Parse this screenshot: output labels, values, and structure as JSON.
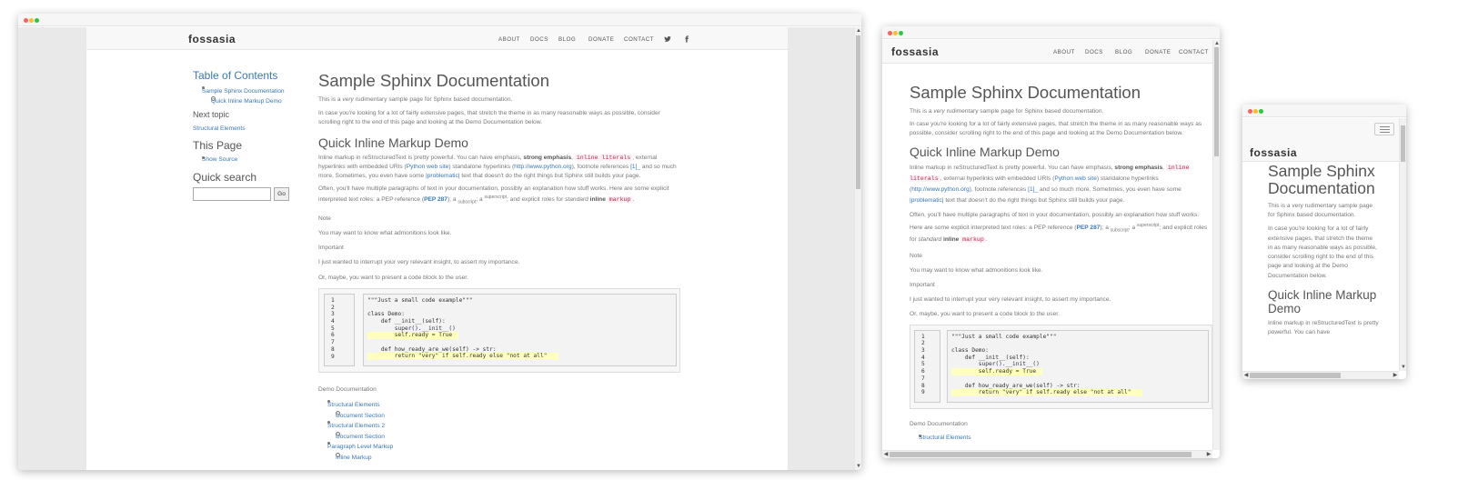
{
  "brand": {
    "logo_text": "fossasia"
  },
  "nav": {
    "about": "ABOUT",
    "docs": "DOCS",
    "blog": "BLOG",
    "donate": "DONATE",
    "contact": "CONTACT"
  },
  "icons": {
    "twitter": "twitter-icon",
    "facebook": "facebook-icon",
    "menu": "hamburger-menu-icon"
  },
  "sidebar": {
    "toc_title": "Table of Contents",
    "toc_items": [
      {
        "label": "Sample Sphinx Documentation",
        "level": 1
      },
      {
        "label": "Quick Inline Markup Demo",
        "level": 2
      }
    ],
    "next_title": "Next topic",
    "next_link": "Structural Elements",
    "this_page_title": "This Page",
    "show_source": "Show Source",
    "search_title": "Quick search",
    "search_value": "",
    "go_label": "Go"
  },
  "doc": {
    "title": "Sample Sphinx Documentation",
    "intro_1": "This is a ",
    "intro_em": "very",
    "intro_2": " rudimentary sample page for Sphinx based documentation.",
    "extensive": "In case you're looking for a lot of fairly extensive pages, that stretch the theme in as many reasonable ways as possible, consider scrolling right to the end of this page and looking at the Demo Documentation below.",
    "section_title": "Quick Inline Markup Demo",
    "markup": {
      "p1": "Inline markup in reStructuredText is pretty powerful. You can have emphasis, ",
      "strong": "strong emphasis",
      "p2": ", ",
      "literal": "inline literals",
      "p3": ", external hyperlinks with embedded URIs (",
      "python_link": "Python web site",
      "p4": ") standalone hyperlinks (",
      "python_url": "http://www.python.org",
      "p5": "), footnote references ",
      "footnote": "[1]_",
      "p6": " and so much more. Sometimes, you even have some ",
      "problematic": "|problematic|",
      "p7": " text that doesn't do the right things but Sphinx still builds your page."
    },
    "roles": {
      "p1": "Often, you'll have multiple paragraphs of text in your documentation, possibly an explanation how stuff works. Here are some explicit interpreted text roles: a PEP reference (",
      "pep": "PEP 287",
      "p2": "); a ",
      "sub": "subscript",
      "p3": "; a ",
      "sup": "superscript",
      "p4": "; and explicit roles for ",
      "standard": "standard",
      "inline": "inline",
      "markup": "markup",
      "p5": "."
    },
    "note": "Note",
    "note_text": "You may want to know what admonitions look like.",
    "important": "Important",
    "important_text": "I just wanted to interrupt your very relevant insight, to assert my importance.",
    "code_intro": "Or, maybe, you want to present a code block to the user.",
    "code_line_numbers": "1\n2\n3\n4\n5\n6\n7\n8\n9",
    "code": [
      "\"\"\"Just a small code example\"\"\"",
      "",
      "class Demo:",
      "    def __init__(self):",
      "        super().__init__()",
      "        self.ready = True",
      "",
      "    def how_ready_are_we(self) -> str:",
      "        return \"very\" if self.ready else \"not at all\""
    ],
    "demo_title": "Demo Documentation",
    "demo_items": [
      {
        "label": "Structural Elements",
        "level": 1
      },
      {
        "label": "Document Section",
        "level": 2
      },
      {
        "label": "Structural Elements 2",
        "level": 1
      },
      {
        "label": "Document Section",
        "level": 2
      },
      {
        "label": "Paragraph Level Markup",
        "level": 1
      },
      {
        "label": "Inline Markup",
        "level": 2
      }
    ]
  },
  "mobile": {
    "title": "Sample Sphinx Documentation",
    "intro": "This is a very rudimentary sample page for Sphinx based documentation.",
    "extensive": "In case you're looking for a lot of fairly extensive pages, that stretch the theme in as many reasonable ways as possible, consider scrolling right to the end of this page and looking at the Demo Documentation below.",
    "section_title": "Quick Inline Markup Demo",
    "markup_start": "Inline markup in reStructuredText is pretty powerful. You can have"
  }
}
